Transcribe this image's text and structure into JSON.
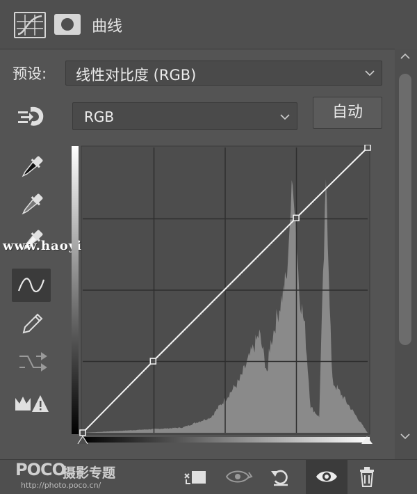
{
  "panel": {
    "title": "曲线"
  },
  "preset": {
    "label": "预设:",
    "value": "线性对比度 (RGB)"
  },
  "channel": {
    "value": "RGB"
  },
  "auto_button": {
    "label": "自动"
  },
  "curve": {
    "points": [
      [
        0,
        0
      ],
      [
        63,
        64
      ],
      [
        191,
        192
      ],
      [
        255,
        255
      ]
    ],
    "range": [
      0,
      255
    ]
  },
  "watermark": {
    "text": "www.haoyidiansheji.com"
  },
  "footer_brand": {
    "logo": "POCO",
    "sub": "摄影专题",
    "url": "http://photo.poco.cn/"
  },
  "colors": {
    "panel_bg": "#545454",
    "graph_bg": "#505050",
    "histogram": "#8c8c8c",
    "curve": "#ffffff"
  }
}
